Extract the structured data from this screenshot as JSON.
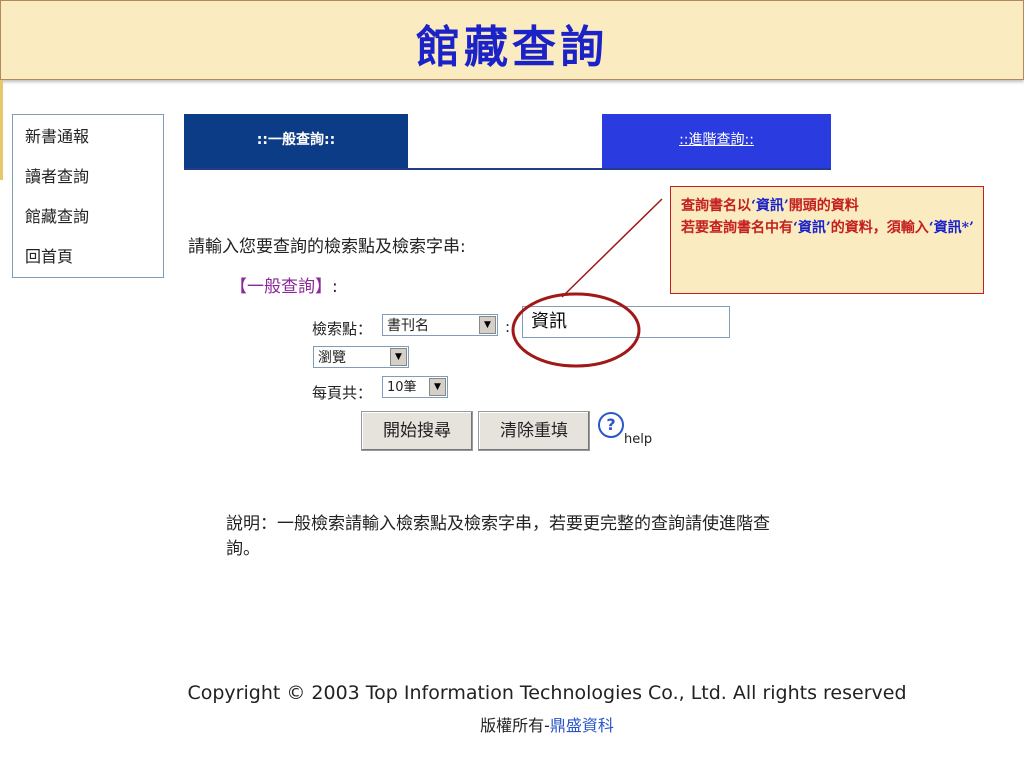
{
  "header": {
    "title": "館藏查詢"
  },
  "nav": {
    "items": [
      {
        "label": "新書通報"
      },
      {
        "label": "讀者查詢"
      },
      {
        "label": "館藏查詢"
      },
      {
        "label": "回首頁"
      }
    ]
  },
  "tabs": {
    "general": "::一般查詢::",
    "advanced": "::進階查詢::"
  },
  "search": {
    "prompt": "請輸入您要查詢的檢索點及檢索字串:",
    "section_label": "【一般查詢】",
    "section_colon": ":",
    "field_label": "檢索點：",
    "field_value": "書刊名",
    "separator": ":",
    "query_value": "資訊",
    "mode_value": "瀏覽",
    "per_page_label": "每頁共：",
    "per_page_value": "10筆",
    "start_button": "開始搜尋",
    "clear_button": "清除重填",
    "help_label": "help"
  },
  "note": {
    "text": "說明：一般檢索請輸入檢索點及檢索字串，若要更完整的查詢請使進階查詢。"
  },
  "callout": {
    "line1_a": "查詢書名以",
    "line1_b": "‘資訊’",
    "line1_c": "開頭的資料",
    "line2_a": "若要查詢書名中有",
    "line2_b": "‘資訊’",
    "line2_c": "的資料，須輸入",
    "line2_d": "‘資訊*’"
  },
  "footer": {
    "copyright": "Copyright © 2003 Top Information Technologies Co., Ltd. All rights reserved",
    "rights_prefix": "版權所有-",
    "rights_brand": "鼎盛資科"
  },
  "colors": {
    "title": "#1a22c8",
    "tab_general": "#0d3c87",
    "tab_advanced": "#2a3be0",
    "callout_text": "#c42020",
    "annotation": "#a01818"
  }
}
